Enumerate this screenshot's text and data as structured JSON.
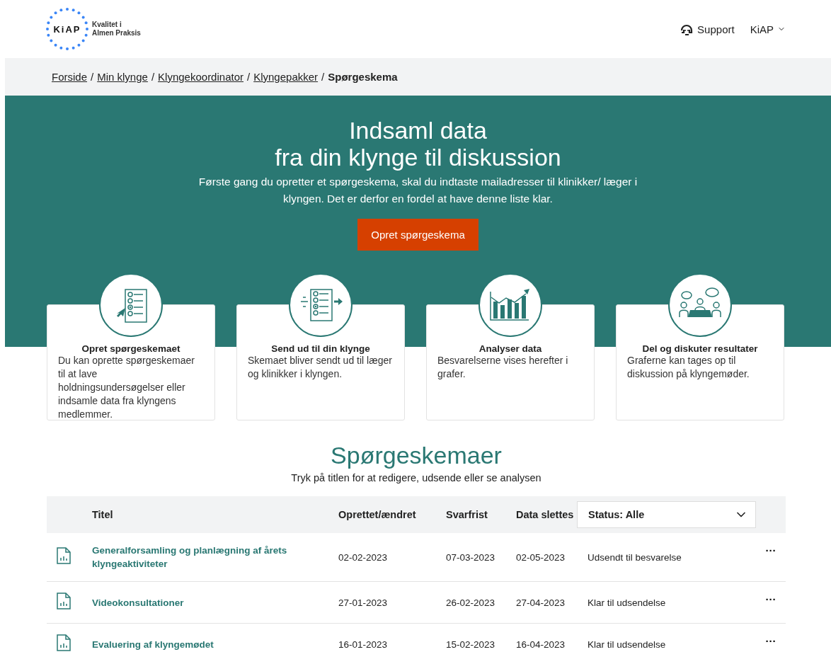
{
  "header": {
    "logo": {
      "mark": "KiAP",
      "tagline_1": "Kvalitet i",
      "tagline_2": "Almen Praksis"
    },
    "support": "Support",
    "user_menu": "KiAP"
  },
  "breadcrumb": {
    "links": [
      "Forside",
      "Min klynge",
      "Klyngekoordinator",
      "Klyngepakker"
    ],
    "separator": "/",
    "current": "Spørgeskema"
  },
  "hero": {
    "title_1": "Indsaml data",
    "title_2": "fra din klynge til diskussion",
    "text": "Første gang du opretter et spørgeskema, skal du indtaste mailadresser til klinikker/ læger i klyngen. Det er derfor en fordel at have denne liste klar.",
    "button": "Opret spørgeskema"
  },
  "steps": [
    {
      "kind": "form",
      "title": "Opret spørgeskemaet",
      "text": "Du kan oprette spørgeskemaer til at lave holdningsundersøgelser eller indsamle data fra klyngens medlemmer."
    },
    {
      "kind": "send",
      "title": "Send ud til din klynge",
      "text": "Skemaet bliver sendt ud til læger og klinikker i klyngen."
    },
    {
      "kind": "chart",
      "title": "Analyser data",
      "text": "Besvarelserne vises herefter i grafer."
    },
    {
      "kind": "meeting",
      "title": "Del og diskuter resultater",
      "text": "Graferne kan tages op til diskussion på klyngemøder."
    }
  ],
  "surveys": {
    "title": "Spørgeskemaer",
    "subtitle": "Tryk på titlen for at redigere, udsende eller se analysen",
    "columns": [
      "Titel",
      "Oprettet/ændret",
      "Svarfrist",
      "Data slettes"
    ],
    "status_filter": "Status: Alle",
    "more": "···",
    "rows": [
      {
        "title": "Generalforsamling og planlægning af årets klyngeaktiviteter",
        "created": "02-02-2023",
        "deadline": "07-03-2023",
        "deleted": "02-05-2023",
        "status": "Udsendt til besvarelse"
      },
      {
        "title": "Videokonsultationer",
        "created": "27-01-2023",
        "deadline": "26-02-2023",
        "deleted": "27-04-2023",
        "status": "Klar til udsendelse"
      },
      {
        "title": "Evaluering af klyngemødet",
        "created": "16-01-2023",
        "deadline": "15-02-2023",
        "deleted": "16-04-2023",
        "status": "Klar til udsendelse"
      }
    ]
  }
}
